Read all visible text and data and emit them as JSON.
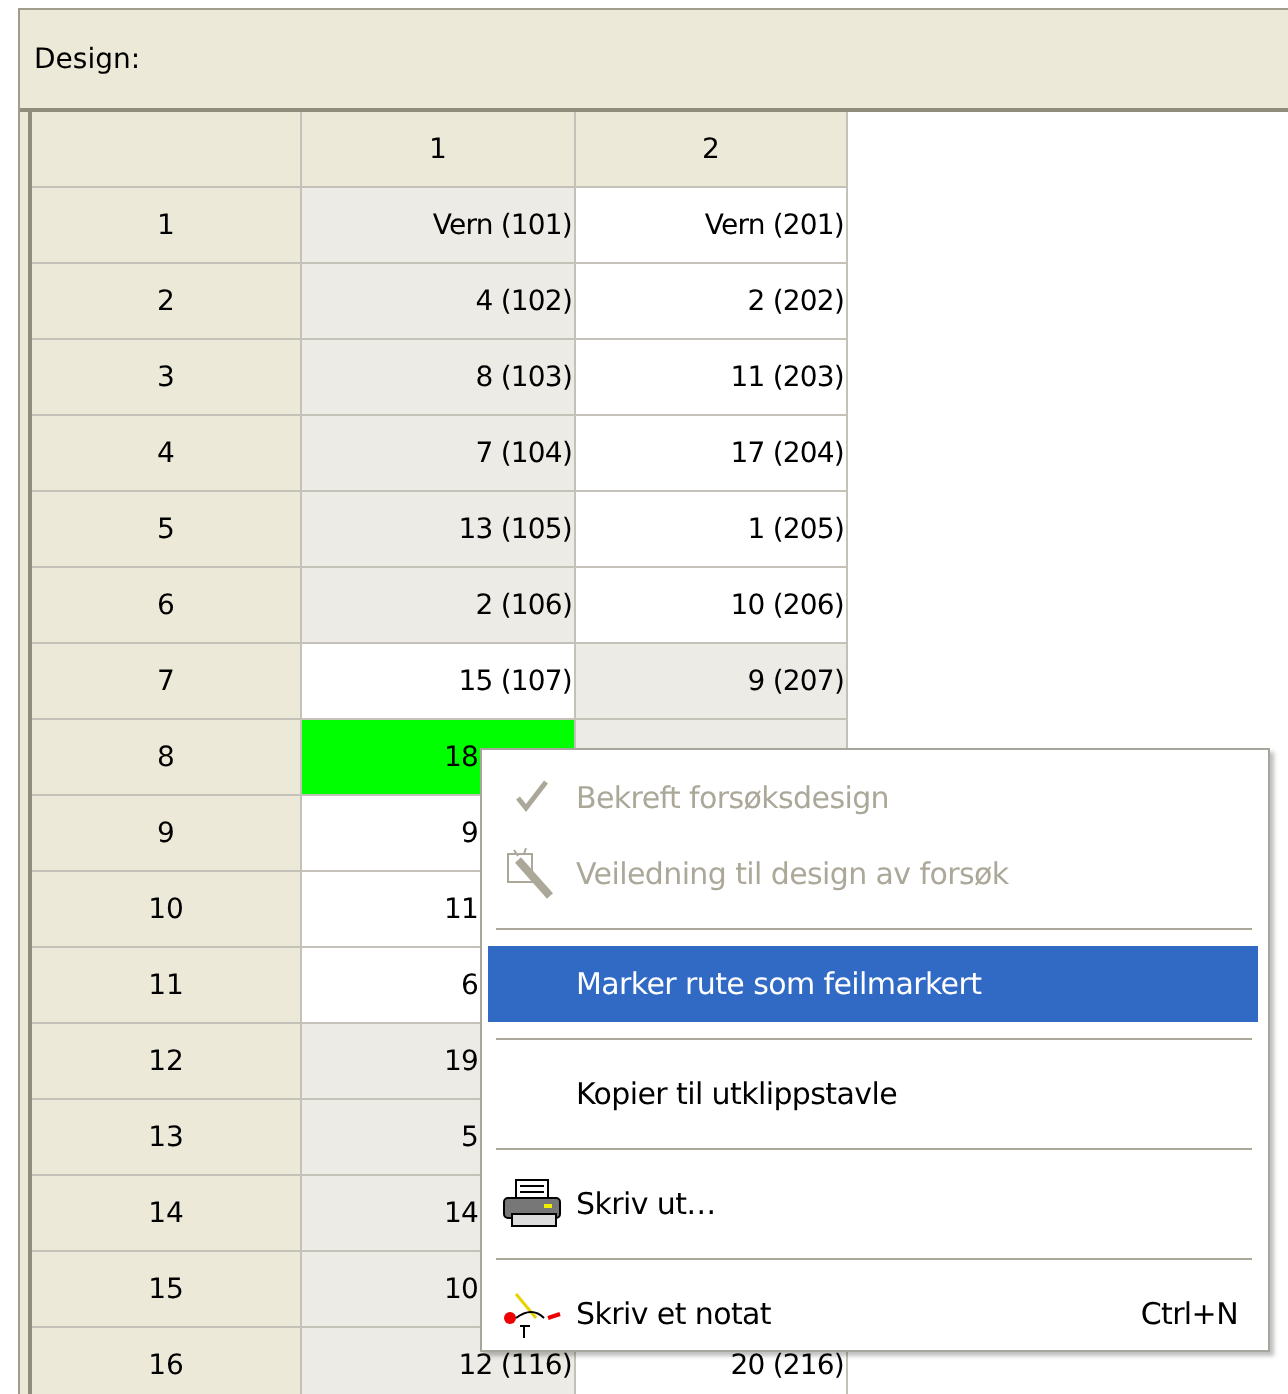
{
  "panel": {
    "title": "Design:"
  },
  "table": {
    "columns": [
      "1",
      "2"
    ],
    "rows": [
      {
        "header": "1",
        "cells": [
          {
            "text": "Vern (101)",
            "color": "#ecebe6",
            "kind": "full"
          },
          {
            "text": "Vern (201)",
            "color": "#ffffff",
            "kind": "full"
          }
        ]
      },
      {
        "header": "2",
        "cells": [
          {
            "text": "4 (102)",
            "color": "#ecebe6",
            "kind": "full"
          },
          {
            "text": "2 (202)",
            "color": "#ffffff",
            "kind": "full"
          }
        ]
      },
      {
        "header": "3",
        "cells": [
          {
            "text": "8 (103)",
            "color": "#ecebe6",
            "kind": "full"
          },
          {
            "text": "11 (203)",
            "color": "#ffffff",
            "kind": "full"
          }
        ]
      },
      {
        "header": "4",
        "cells": [
          {
            "text": "7 (104)",
            "color": "#ecebe6",
            "kind": "full"
          },
          {
            "text": "17 (204)",
            "color": "#ffffff",
            "kind": "full"
          }
        ]
      },
      {
        "header": "5",
        "cells": [
          {
            "text": "13 (105)",
            "color": "#ecebe6",
            "kind": "full"
          },
          {
            "text": "1 (205)",
            "color": "#ffffff",
            "kind": "full"
          }
        ]
      },
      {
        "header": "6",
        "cells": [
          {
            "text": "2 (106)",
            "color": "#ecebe6",
            "kind": "full"
          },
          {
            "text": "10 (206)",
            "color": "#ffffff",
            "kind": "full"
          }
        ]
      },
      {
        "header": "7",
        "cells": [
          {
            "text": "15 (107)",
            "color": "#ffffff",
            "kind": "full"
          },
          {
            "text": "9 (207)",
            "color": "#ecebe6",
            "kind": "full"
          }
        ]
      },
      {
        "header": "8",
        "cells": [
          {
            "text": "18",
            "color": "#00ff00",
            "kind": "cut"
          },
          {
            "color": "#ecebe6",
            "kind": "hidden"
          }
        ]
      },
      {
        "header": "9",
        "cells": [
          {
            "text": "9",
            "color": "#ffffff",
            "kind": "cut"
          },
          {
            "kind": "covered"
          }
        ]
      },
      {
        "header": "10",
        "cells": [
          {
            "text": "11",
            "color": "#ffffff",
            "kind": "cut"
          },
          {
            "kind": "covered"
          }
        ]
      },
      {
        "header": "11",
        "cells": [
          {
            "text": "6",
            "color": "#ffffff",
            "kind": "cut"
          },
          {
            "kind": "covered"
          }
        ]
      },
      {
        "header": "12",
        "cells": [
          {
            "text": "19",
            "color": "#ecebe6",
            "kind": "cut"
          },
          {
            "kind": "covered"
          }
        ]
      },
      {
        "header": "13",
        "cells": [
          {
            "text": "5",
            "color": "#ecebe6",
            "kind": "cut"
          },
          {
            "kind": "covered"
          }
        ]
      },
      {
        "header": "14",
        "cells": [
          {
            "text": "14",
            "color": "#ecebe6",
            "kind": "cut"
          },
          {
            "kind": "covered"
          }
        ]
      },
      {
        "header": "15",
        "cells": [
          {
            "text": "10",
            "color": "#ecebe6",
            "kind": "cut"
          },
          {
            "kind": "covered"
          }
        ]
      },
      {
        "header": "16",
        "cells": [
          {
            "text": "12 (116)",
            "color": "#ecebe6",
            "kind": "full"
          },
          {
            "text": "20 (216)",
            "color": "#ffffff",
            "kind": "full"
          }
        ]
      }
    ]
  },
  "context_menu": {
    "items": [
      {
        "kind": "check",
        "label": "Bekreft forsøksdesign",
        "disabled": true,
        "selected": false
      },
      {
        "kind": "wand",
        "label": "Veiledning til design av forsøk",
        "disabled": true,
        "selected": false
      },
      {
        "kind": "separator"
      },
      {
        "kind": "text",
        "label": "Marker rute som feilmarkert",
        "disabled": false,
        "selected": true
      },
      {
        "kind": "separator"
      },
      {
        "kind": "text",
        "label": "Kopier til utklippstavle",
        "disabled": false,
        "selected": false
      },
      {
        "kind": "separator"
      },
      {
        "kind": "printer",
        "label": "Skriv ut…",
        "disabled": false,
        "selected": false
      },
      {
        "kind": "separator"
      },
      {
        "kind": "note",
        "label": "Skriv et notat",
        "shortcut": "Ctrl+N",
        "disabled": false,
        "selected": false
      }
    ]
  }
}
